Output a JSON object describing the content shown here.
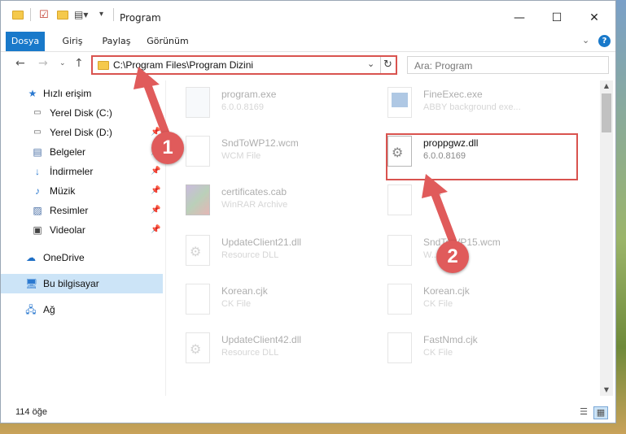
{
  "window": {
    "title": "Program",
    "minimize_icon": "minimize-icon",
    "maximize_icon": "maximize-icon",
    "close_icon": "close-icon"
  },
  "ribbon": {
    "tabs": [
      {
        "label": "Dosya",
        "active": true
      },
      {
        "label": "Giriş",
        "active": false
      },
      {
        "label": "Paylaş",
        "active": false
      },
      {
        "label": "Görünüm",
        "active": false
      }
    ],
    "accent": "#1979ca"
  },
  "address": {
    "path": "C:\\Program Files\\Program Dizini"
  },
  "search": {
    "placeholder": "Ara: Program"
  },
  "sidebar": {
    "items": [
      {
        "label": "Hızlı erişim",
        "icon": "star-icon",
        "pinned": false
      },
      {
        "label": "Yerel Disk (C:)",
        "icon": "drive-icon",
        "pinned": false
      },
      {
        "label": "Yerel Disk (D:)",
        "icon": "drive-icon",
        "pinned": true
      },
      {
        "label": "Belgeler",
        "icon": "documents-icon",
        "pinned": true
      },
      {
        "label": "İndirmeler",
        "icon": "download-icon",
        "pinned": true
      },
      {
        "label": "Müzik",
        "icon": "music-icon",
        "pinned": true
      },
      {
        "label": "Resimler",
        "icon": "pictures-icon",
        "pinned": true
      },
      {
        "label": "Videolar",
        "icon": "video-icon",
        "pinned": true
      },
      {
        "label": "OneDrive",
        "icon": "cloud-icon",
        "pinned": false
      },
      {
        "label": "Bu bilgisayar",
        "icon": "computer-icon",
        "pinned": false,
        "selected": true
      },
      {
        "label": "Ağ",
        "icon": "network-icon",
        "pinned": false
      }
    ]
  },
  "files": [
    {
      "name": "program.exe",
      "sub": "6.0.0.8169",
      "icon": "exe-icon"
    },
    {
      "name": "FineExec.exe",
      "sub": "ABBY background exe...",
      "icon": "app-icon"
    },
    {
      "name": "SndToWP12.wcm",
      "sub": "WCM File",
      "icon": "file-icon"
    },
    {
      "name": "proppgwz.dll",
      "sub": "6.0.0.8169",
      "icon": "dll-icon",
      "highlighted": true
    },
    {
      "name": "certificates.cab",
      "sub": "WinRAR Archive",
      "icon": "archive-icon"
    },
    {
      "name": "...ck",
      "sub": "",
      "icon": "file-icon"
    },
    {
      "name": "UpdateClient21.dll",
      "sub": "Resource DLL",
      "icon": "dll-icon"
    },
    {
      "name": "SndToWP15.wcm",
      "sub": "W...",
      "icon": "file-icon"
    },
    {
      "name": "Korean.cjk",
      "sub": "CK File",
      "icon": "file-icon"
    },
    {
      "name": "Korean.cjk",
      "sub": "CK File",
      "icon": "file-icon"
    },
    {
      "name": "UpdateClient42.dll",
      "sub": "Resource DLL",
      "icon": "dll-icon"
    },
    {
      "name": "FastNmd.cjk",
      "sub": "CK File",
      "icon": "file-icon"
    }
  ],
  "status": {
    "count": "114 öğe"
  },
  "annotations": {
    "step1": "1",
    "step2": "2",
    "color": "#e05b5b"
  }
}
